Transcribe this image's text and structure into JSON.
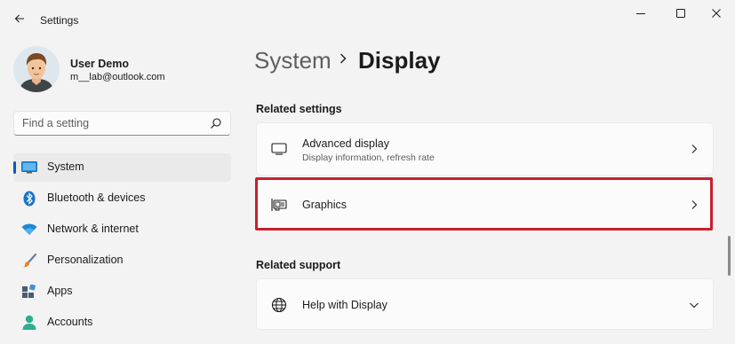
{
  "window": {
    "title": "Settings",
    "controls": {
      "minimize": "minimize-icon",
      "maximize": "maximize-icon",
      "close": "close-icon"
    }
  },
  "user": {
    "name": "User Demo",
    "email": "m__lab@outlook.com"
  },
  "search": {
    "placeholder": "Find a setting"
  },
  "nav": {
    "items": [
      {
        "label": "System",
        "icon": "system-icon",
        "active": true
      },
      {
        "label": "Bluetooth & devices",
        "icon": "bluetooth-icon"
      },
      {
        "label": "Network & internet",
        "icon": "wifi-icon"
      },
      {
        "label": "Personalization",
        "icon": "brush-icon"
      },
      {
        "label": "Apps",
        "icon": "apps-icon"
      },
      {
        "label": "Accounts",
        "icon": "accounts-icon"
      }
    ]
  },
  "breadcrumb": {
    "parent": "System",
    "current": "Display"
  },
  "related_settings": {
    "title": "Related settings",
    "items": [
      {
        "title": "Advanced display",
        "subtitle": "Display information, refresh rate",
        "icon": "monitor-icon"
      },
      {
        "title": "Graphics",
        "icon": "graphics-card-icon",
        "highlighted": true
      }
    ]
  },
  "related_support": {
    "title": "Related support",
    "items": [
      {
        "title": "Help with Display",
        "icon": "globe-icon",
        "expandable": true
      }
    ]
  },
  "colors": {
    "accent": "#005fb8",
    "highlight": "#c8202c",
    "background": "#f3f3f3",
    "card": "#fbfbfb"
  }
}
